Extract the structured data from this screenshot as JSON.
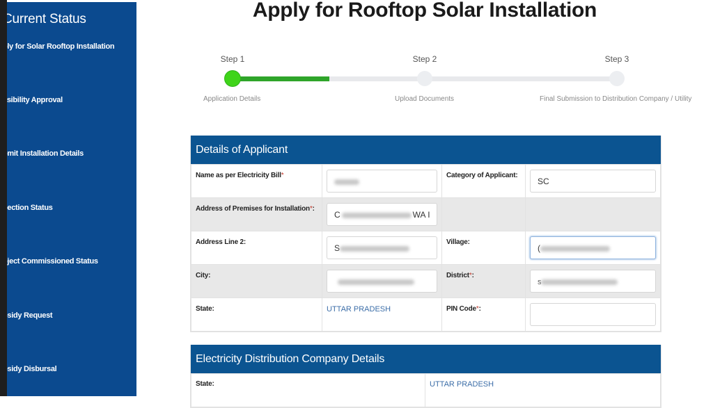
{
  "sidebar": {
    "title": "Current Status",
    "items": [
      {
        "label": "Apply for Solar Rooftop Installation"
      },
      {
        "label": "Feasibility Approval"
      },
      {
        "label": "Submit Installation Details"
      },
      {
        "label": "Inspection Status"
      },
      {
        "label": "Project Commissioned Status"
      },
      {
        "label": "Subsidy Request"
      },
      {
        "label": "Subsidy Disbursal"
      }
    ],
    "visible_labels": [
      "ply for Solar Rooftop Installation",
      "asibility Approval",
      "omit Installation Details",
      "pection Status",
      "oject Commissioned Status",
      "osidy Request",
      "osidy Disbursal"
    ],
    "visible_title": "Current Status"
  },
  "page": {
    "title": "Apply for Rooftop Solar Installation"
  },
  "stepper": {
    "progress_fraction": 0.25,
    "current_step": 1,
    "steps": [
      {
        "label": "Step 1",
        "description": "Application Details"
      },
      {
        "label": "Step 2",
        "description": "Upload Documents"
      },
      {
        "label": "Step 3",
        "description": "Final Submission to Distribution Company / Utility"
      }
    ]
  },
  "applicant": {
    "header": "Details of Applicant",
    "fields": {
      "name": {
        "label": "Name as per Electricity Bill",
        "required": "*",
        "value": "[redacted]"
      },
      "category": {
        "label": "Category of Applicant:",
        "value": "SC"
      },
      "address": {
        "label": "Address of Premises for Installation",
        "required": "*",
        "suffix": ":",
        "value_start": "C",
        "value_end": "WA I"
      },
      "address2": {
        "label": "Address Line 2:",
        "value_start": "S"
      },
      "village": {
        "label": "Village:",
        "value_start": "("
      },
      "city": {
        "label": "City:",
        "value": ""
      },
      "district": {
        "label": "District",
        "required": "*",
        "suffix": ":",
        "value_start": "S"
      },
      "state": {
        "label": "State:",
        "value": "UTTAR PRADESH"
      },
      "pin": {
        "label": "PIN Code",
        "required": "*",
        "suffix": ":",
        "value": ""
      }
    }
  },
  "discom": {
    "header": "Electricity Distribution Company Details",
    "state_label": "State:",
    "state_value": "UTTAR PRADESH"
  },
  "colors": {
    "sidebar_bg": "#0b4a8f",
    "panel_header_bg": "#0b5491",
    "step_active": "#3fd41a",
    "progress_fill": "#2fa52a",
    "link_text": "#3c6ea8"
  }
}
